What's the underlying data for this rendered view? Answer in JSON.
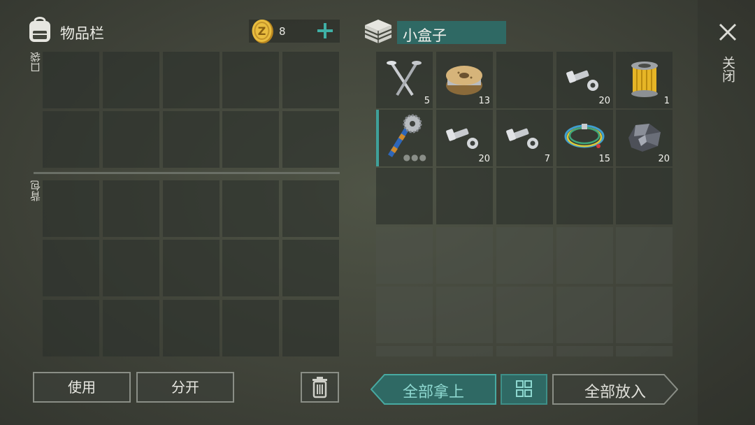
{
  "inventory": {
    "title": "物品栏",
    "pocket_label": "口袋",
    "backpack_label": "背包",
    "coins": "8"
  },
  "container": {
    "title": "小盒子",
    "items": [
      {
        "name": "nails",
        "qty": "5"
      },
      {
        "name": "wire-spool",
        "qty": "13"
      },
      {
        "name": "empty",
        "qty": ""
      },
      {
        "name": "bolts",
        "qty": "20"
      },
      {
        "name": "oil-filter",
        "qty": "1"
      },
      {
        "name": "saw-blade-club",
        "qty": ""
      },
      {
        "name": "bolts",
        "qty": "20"
      },
      {
        "name": "bolts",
        "qty": "7"
      },
      {
        "name": "cable-coil",
        "qty": "15"
      },
      {
        "name": "iron-ore",
        "qty": "20"
      }
    ]
  },
  "close_label": "关闭",
  "buttons": {
    "use": "使用",
    "split": "分开",
    "take_all": "全部拿上",
    "put_all": "全部放入"
  },
  "colors": {
    "accent_teal": "#2f6964",
    "teal_light": "#46b2a8",
    "slot_bg": "#2b302c",
    "coin_gold": "#e0b23a"
  }
}
